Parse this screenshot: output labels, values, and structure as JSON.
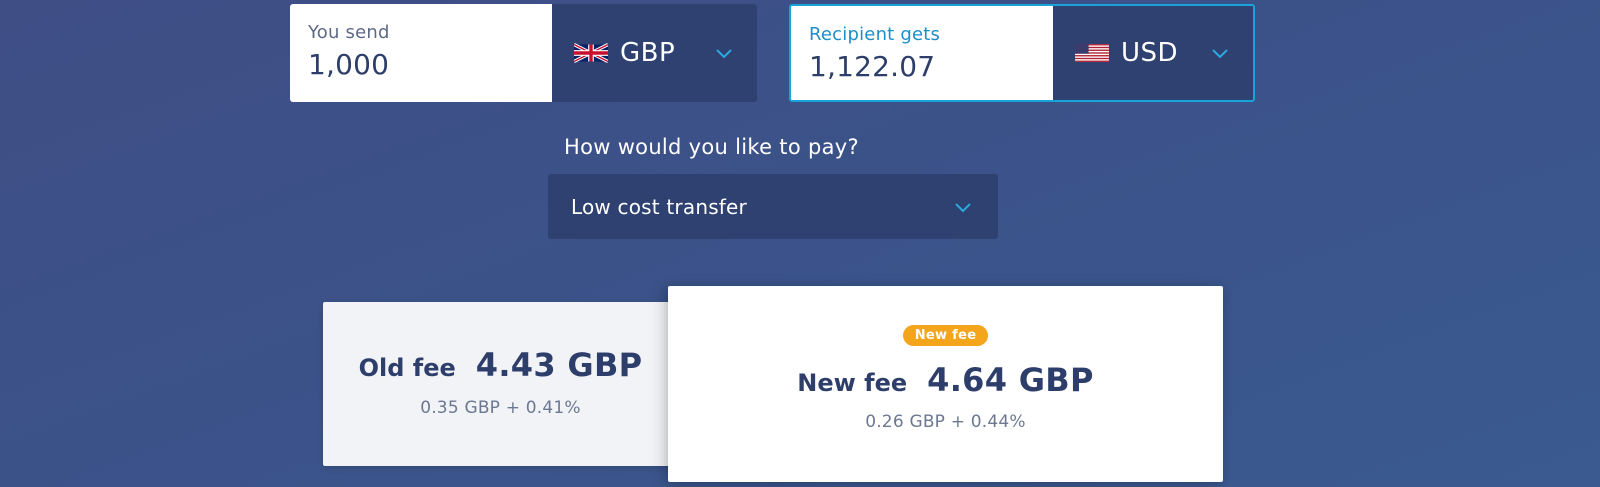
{
  "send": {
    "label": "You send",
    "amount": "1,000",
    "currency": "GBP",
    "flag_icon": "uk-flag-icon"
  },
  "receive": {
    "label": "Recipient gets",
    "amount": "1,122.07",
    "currency": "USD",
    "flag_icon": "us-flag-icon"
  },
  "payment": {
    "question": "How would you like to pay?",
    "selected": "Low cost transfer"
  },
  "old_fee": {
    "title": "Old fee",
    "amount": "4.43 GBP",
    "breakdown": "0.35 GBP + 0.41%"
  },
  "new_fee": {
    "badge": "New fee",
    "title": "New fee",
    "amount": "4.64 GBP",
    "breakdown": "0.26 GBP + 0.44%"
  },
  "colors": {
    "background": "#3d5289",
    "panel_dark": "#2e4170",
    "accent_blue": "#1aa3d9",
    "badge_orange": "#f4a51c",
    "text_dark": "#2e3e6b"
  }
}
